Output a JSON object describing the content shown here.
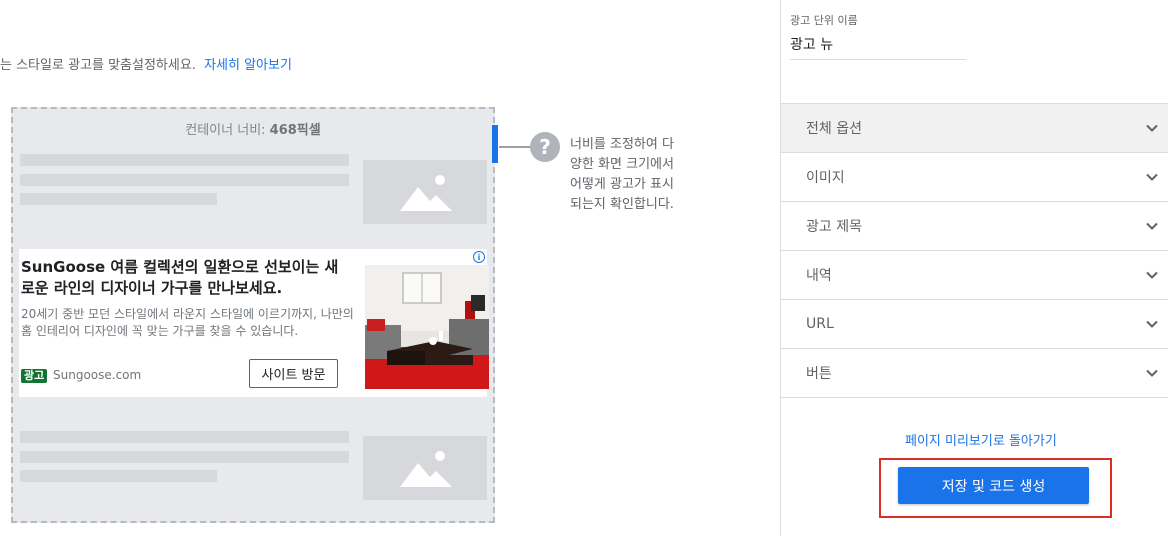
{
  "intro": {
    "text": "는 스타일로 광고를 맞춤설정하세요.",
    "link": "자세히 알아보기"
  },
  "preview": {
    "container_label_prefix": "컨테이너 너비: ",
    "container_width": "468픽셀",
    "ad": {
      "title": "SunGoose 여름 컬렉션의 일환으로 선보이는 새로운 라인의 디자이너 가구를 만나보세요.",
      "description": "20세기 중반 모던 스타일에서 라운지 스타일에 이르기까지, 나만의 홈 인테리어 디자인에 꼭 맞는 가구를 찾을 수 있습니다.",
      "badge": "광고",
      "domain": "Sungoose.com",
      "button": "사이트 방문",
      "adchoices": "i"
    },
    "hint": "너비를 조정하여 다양한 화면 크기에서 어떻게 광고가 표시되는지 확인합니다.",
    "hint_icon": "?"
  },
  "panel": {
    "name_label": "광고 단위 이름",
    "name_value": "광고 뉴",
    "sections": [
      {
        "label": "전체 옵션"
      },
      {
        "label": "이미지"
      },
      {
        "label": "광고 제목"
      },
      {
        "label": "내역"
      },
      {
        "label": "URL"
      },
      {
        "label": "버튼"
      }
    ],
    "back_link": "페이지 미리보기로 돌아가기",
    "save_button": "저장 및 코드 생성"
  },
  "colors": {
    "accent": "#1a73e8",
    "highlight": "#d93025",
    "badge": "#137333"
  }
}
